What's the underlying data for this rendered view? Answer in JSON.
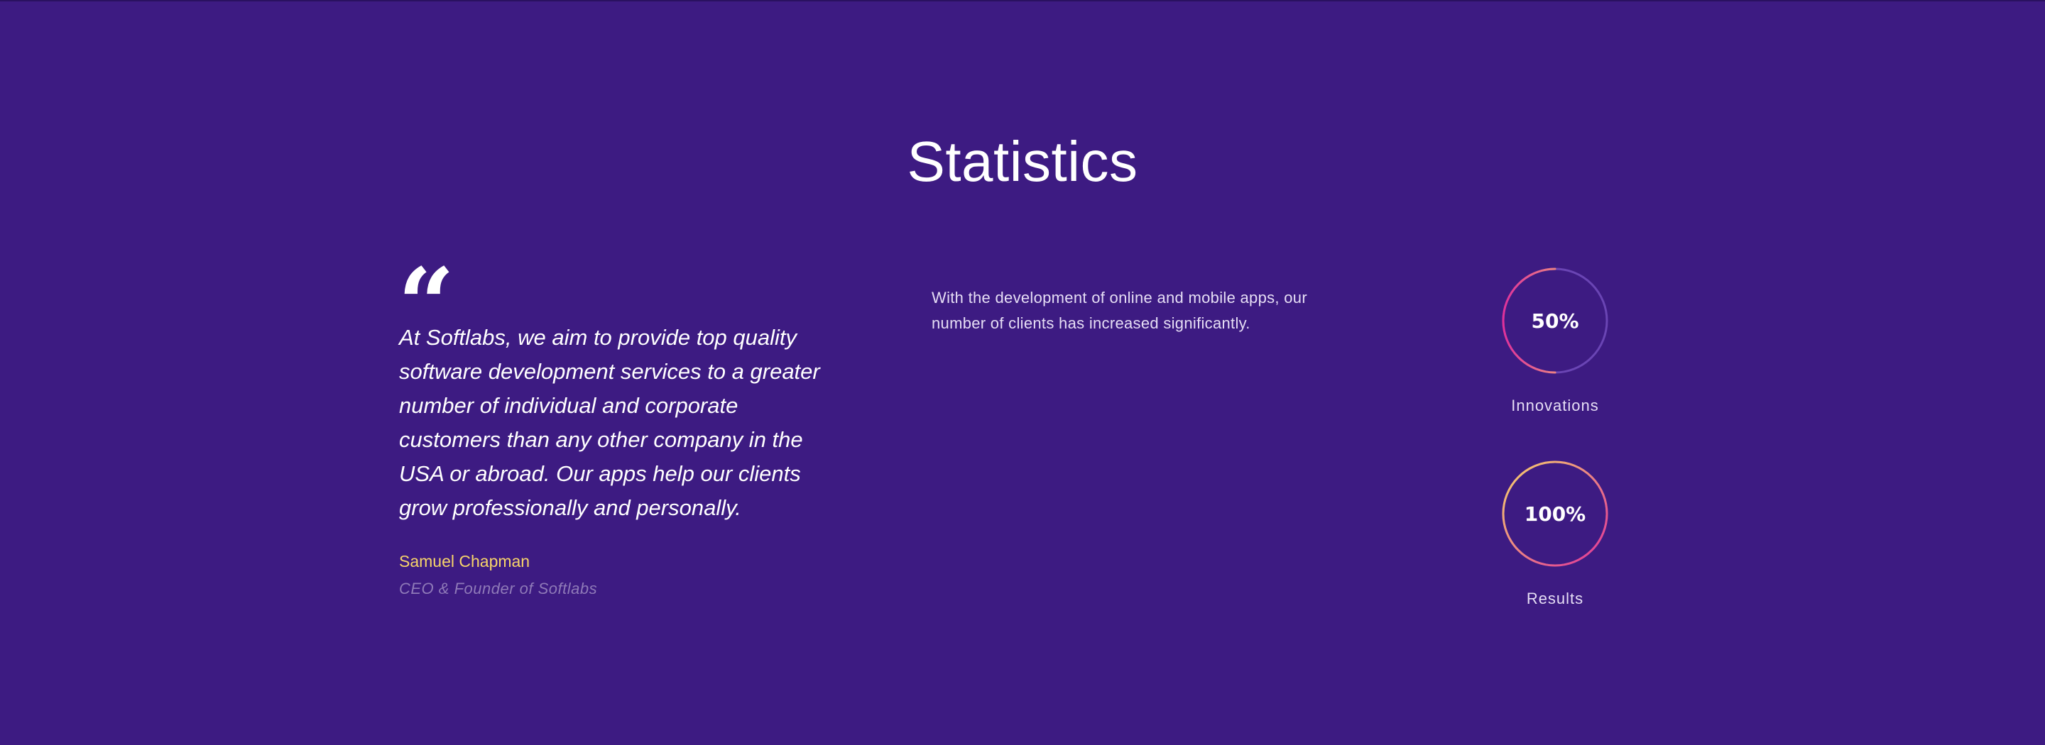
{
  "section": {
    "title": "Statistics"
  },
  "quote": {
    "text": "At Softlabs, we aim to provide top quality software development services to a greater number of individual and corporate customers than any other company in the USA or abroad. Our apps help our clients grow professionally and personally.",
    "author": "Samuel Chapman",
    "role": "CEO & Founder of Softlabs"
  },
  "description": "With the development of online and mobile apps, our number of clients has increased significantly.",
  "stats": [
    {
      "value_label": "50%",
      "progress": 0.5,
      "label": "Innovations"
    },
    {
      "value_label": "100%",
      "progress": 1.0,
      "label": "Results"
    }
  ],
  "colors": {
    "background": "#3d1b82",
    "accent_yellow": "#f7d46a",
    "accent_pink": "#e0309a",
    "track": "#6a45b4",
    "icon": "quote-mark-icon"
  }
}
